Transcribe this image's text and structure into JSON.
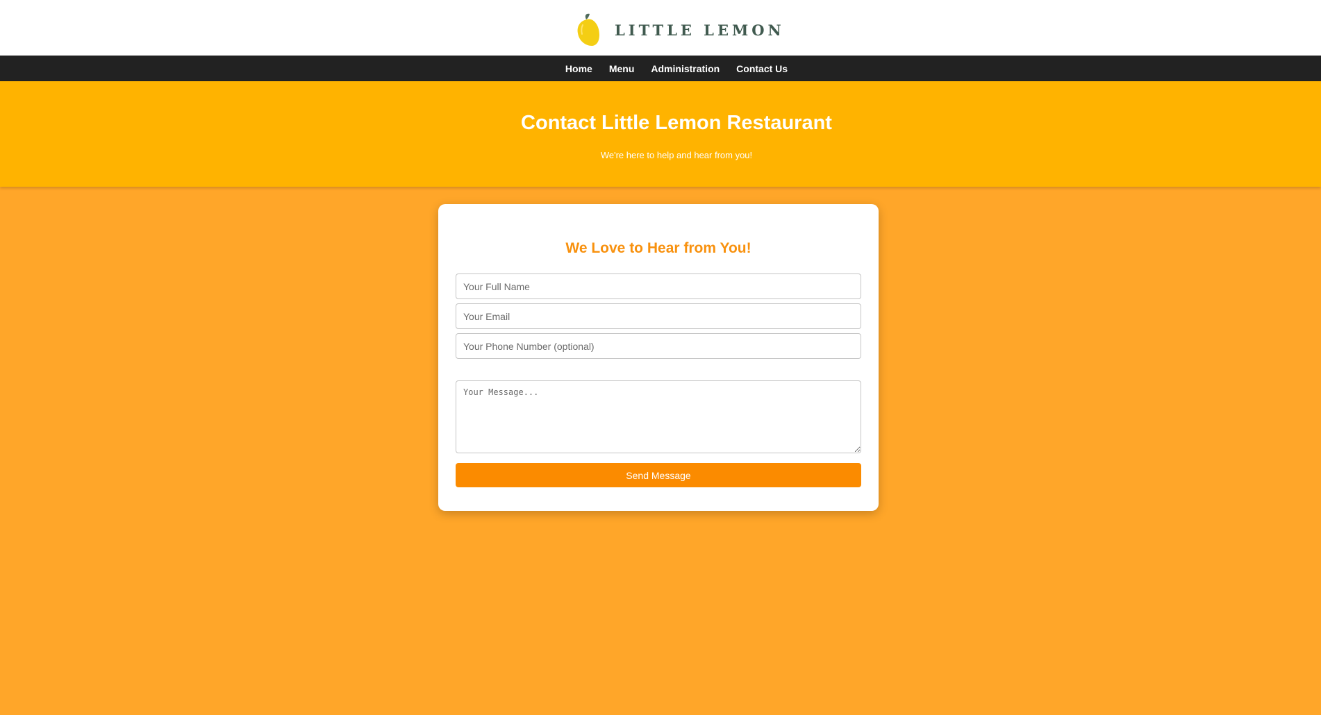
{
  "brand": {
    "name": "LITTLE LEMON",
    "logo_icon": "lemon-icon"
  },
  "nav": {
    "items": [
      {
        "label": "Home"
      },
      {
        "label": "Menu"
      },
      {
        "label": "Administration"
      },
      {
        "label": "Contact Us"
      }
    ]
  },
  "hero": {
    "title": "Contact Little Lemon Restaurant",
    "subtitle": "We're here to help and hear from you!"
  },
  "form": {
    "heading": "We Love to Hear from You!",
    "name_placeholder": "Your Full Name",
    "email_placeholder": "Your Email",
    "phone_placeholder": "Your Phone Number (optional)",
    "message_placeholder": "Your Message...",
    "submit_label": "Send Message"
  },
  "colors": {
    "page_background": "#FFA629",
    "hero_background": "#FFB300",
    "navbar_background": "#222222",
    "accent": "#F8910E",
    "button": "#FB8B00",
    "brand_text": "#405A4F"
  }
}
